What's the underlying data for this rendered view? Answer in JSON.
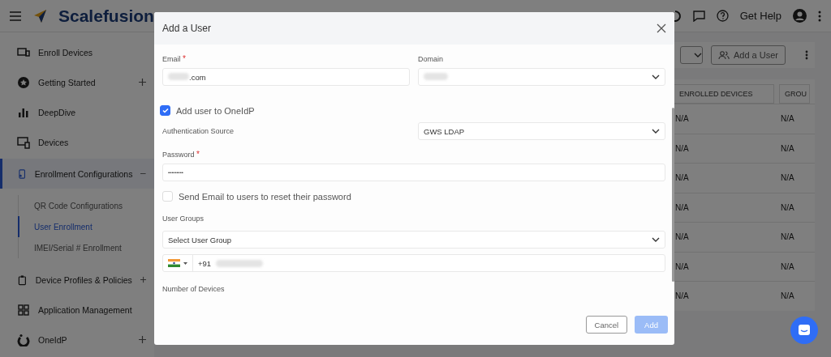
{
  "topbar": {
    "brand": "Scalefusion",
    "help": "Get Help"
  },
  "sidebar": {
    "items": [
      {
        "label": "Enroll Devices",
        "selected": false
      },
      {
        "label": "Getting Started",
        "selected": false,
        "expanded": false
      },
      {
        "label": "DeepDive",
        "selected": false
      },
      {
        "label": "Devices",
        "selected": false
      },
      {
        "label": "Enrollment Configurations",
        "selected": true,
        "expanded": true,
        "children": [
          {
            "label": "QR Code Configurations",
            "selected": false
          },
          {
            "label": "User Enrollment",
            "selected": true
          },
          {
            "label": "IMEI/Serial # Enrollment",
            "selected": false
          }
        ]
      },
      {
        "label": "Device Profiles & Policies",
        "selected": false,
        "expanded": false
      },
      {
        "label": "Application Management",
        "selected": false
      },
      {
        "label": "OneIdP",
        "selected": false,
        "expanded": false
      }
    ]
  },
  "toolbar": {
    "add_button": "Add a User"
  },
  "table": {
    "columns": [
      "ENROLLED DEVICES",
      "GROU"
    ],
    "rows": [
      [
        "N/A",
        "N/A"
      ],
      [
        "N/A",
        "N/A"
      ],
      [
        "N/A",
        "N/A"
      ],
      [
        "N/A",
        "N/A"
      ],
      [
        "N/A",
        "N/A"
      ],
      [
        "N/A",
        "N/A"
      ],
      [
        "N/A",
        "N/A"
      ]
    ]
  },
  "dialog": {
    "title": "Add a User",
    "email": {
      "label": "Email",
      "required_mark": "*",
      "value": ".com"
    },
    "domain": {
      "label": "Domain"
    },
    "add_to_oneidp": {
      "label": "Add user to OneIdP",
      "checked": true
    },
    "auth_source": {
      "label": "Authentication Source",
      "value": "GWS LDAP"
    },
    "password": {
      "label": "Password",
      "required_mark": "*",
      "value": "•••••••••"
    },
    "send_email": {
      "label": "Send Email to users to reset their password",
      "checked": false
    },
    "user_groups": {
      "label": "User Groups",
      "placeholder": "Select User Group"
    },
    "phone": {
      "code": "+91"
    },
    "devices": {
      "label": "Number of Devices"
    },
    "buttons": [
      {
        "label": "Cancel",
        "kind": "secondary",
        "disabled": false
      },
      {
        "label": "Add",
        "kind": "primary",
        "disabled": true
      }
    ]
  }
}
